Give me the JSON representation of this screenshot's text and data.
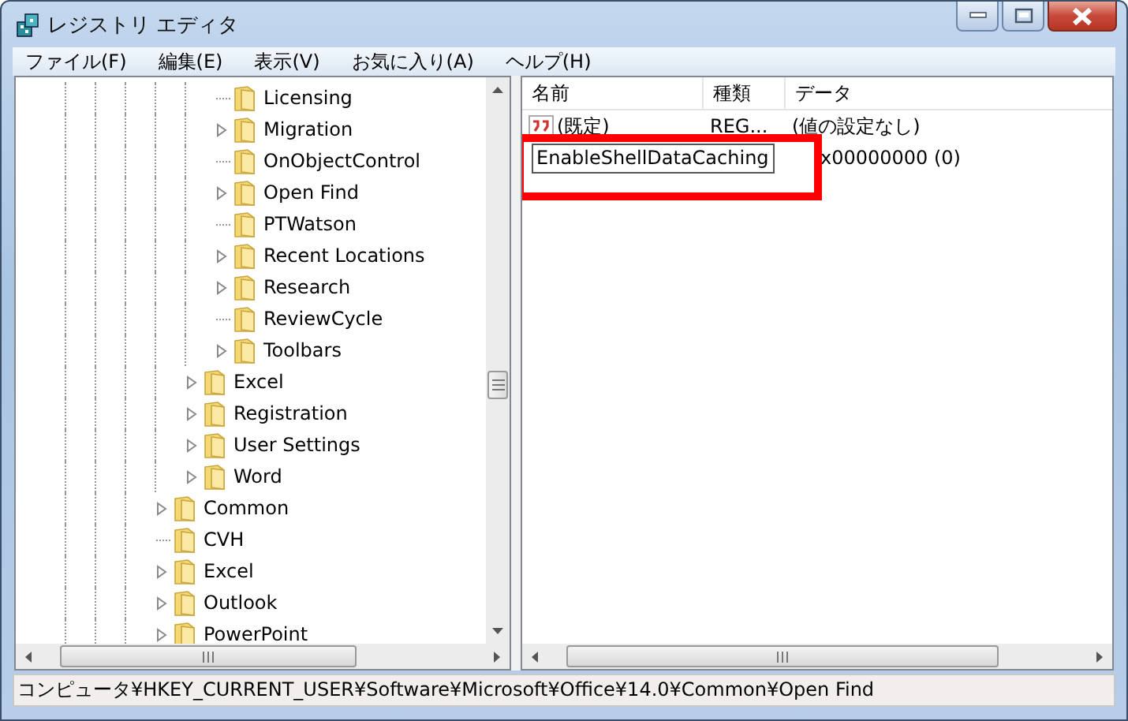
{
  "window": {
    "title": "レジストリ エディタ"
  },
  "menu": [
    "ファイル(F)",
    "編集(E)",
    "表示(V)",
    "お気に入り(A)",
    "ヘルプ(H)"
  ],
  "tree": [
    {
      "children": [
        {
          "children": [
            {
              "label": "Licensing",
              "expandable": false
            },
            {
              "label": "Migration",
              "expandable": true
            },
            {
              "label": "OnObjectControl",
              "expandable": false
            },
            {
              "label": "Open Find",
              "expandable": true
            },
            {
              "label": "PTWatson",
              "expandable": false
            },
            {
              "label": "Recent Locations",
              "expandable": true
            },
            {
              "label": "Research",
              "expandable": true
            },
            {
              "label": "ReviewCycle",
              "expandable": false
            },
            {
              "label": "Toolbars",
              "expandable": true
            }
          ]
        },
        {
          "label": "Excel",
          "expandable": true
        },
        {
          "label": "Registration",
          "expandable": true
        },
        {
          "label": "User Settings",
          "expandable": true
        },
        {
          "label": "Word",
          "expandable": true
        }
      ]
    },
    {
      "label": "Common",
      "expandable": true
    },
    {
      "label": "CVH",
      "expandable": false
    },
    {
      "label": "Excel",
      "expandable": true
    },
    {
      "label": "Outlook",
      "expandable": true
    },
    {
      "label": "PowerPoint",
      "expandable": true
    }
  ],
  "list": {
    "columns": [
      "名前",
      "種類",
      "データ"
    ],
    "rows": [
      {
        "kind": "string",
        "name": "(既定)",
        "type": "REG...",
        "data": "(値の設定なし)"
      },
      {
        "kind": "binary",
        "editing": true,
        "name": "EnableShellDataCaching",
        "data": "x00000000 (0)"
      }
    ]
  },
  "status_bar": "コンピュータ¥HKEY_CURRENT_USER¥Software¥Microsoft¥Office¥14.0¥Common¥Open Find"
}
